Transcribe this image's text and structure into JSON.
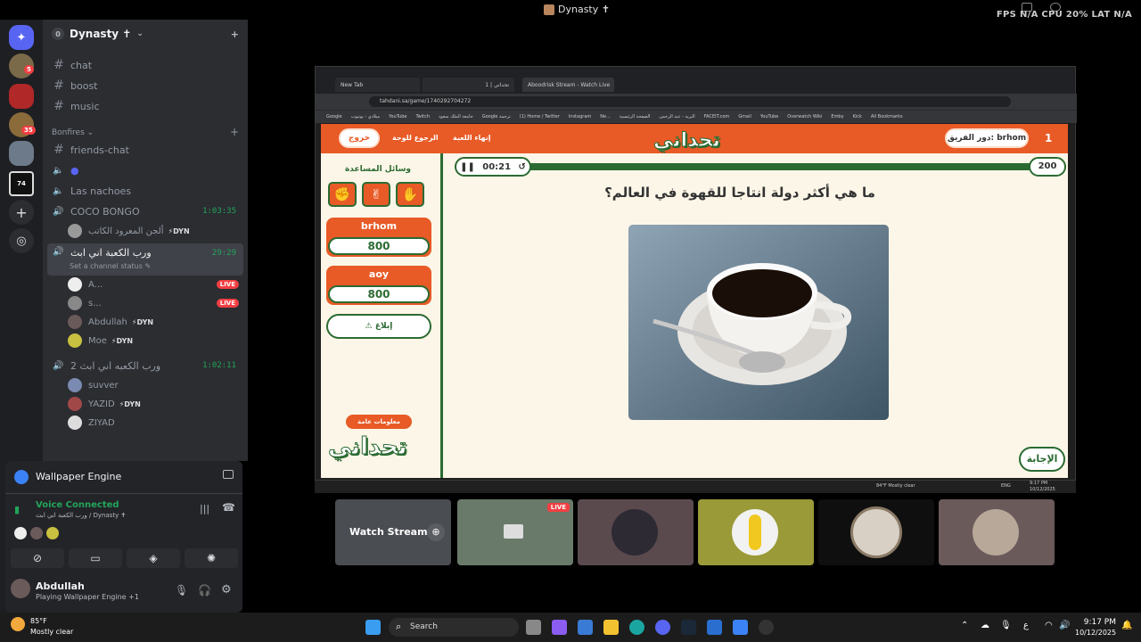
{
  "titlebar": {
    "title": "Dynasty ✝",
    "stats": "FPS N/A   CPU 20%   LAT N/A"
  },
  "server": {
    "name": "Dynasty ✝",
    "level": "0"
  },
  "guild_badges": [
    "5",
    "35"
  ],
  "channels": {
    "text": [
      "chat",
      "boost",
      "music"
    ],
    "category": "Bonfires",
    "friends_chat": "friends-chat",
    "voice_nachoes": "Las nachoes",
    "coco": {
      "name": "COCO BONGO",
      "time": "1:03:35"
    },
    "coco_user": {
      "name": "ألجن المعرود الكاتب",
      "tag": "⚡DYN"
    },
    "active": {
      "name": "ورب الكعبة اني ابث",
      "status": "Set a channel status ✎",
      "time": "29:29"
    },
    "active_users": [
      {
        "name": "A...",
        "live": "LIVE"
      },
      {
        "name": "s...",
        "live": "LIVE"
      },
      {
        "name": "Abdullah",
        "tag": "⚡DYN"
      },
      {
        "name": "Moe",
        "tag": "⚡DYN"
      }
    ],
    "second": {
      "name": "ورب الكعبه اني ابث 2",
      "time": "1:02:11"
    },
    "second_users": [
      {
        "name": "suvver"
      },
      {
        "name": "YAZID",
        "tag": "⚡DYN"
      },
      {
        "name": "ZIYAD"
      }
    ]
  },
  "panel": {
    "activity": "Wallpaper Engine",
    "voice_status": "Voice Connected",
    "voice_channel": "ورب الكعبة اني ابث / Dynasty ✝",
    "user_name": "Abdullah",
    "user_status": "Playing Wallpaper Engine +1"
  },
  "browser": {
    "tabs": [
      "New Tab",
      "تحداني | 1",
      "Aboodrisk Stream - Watch Live"
    ],
    "url": "tahdani.sa/game/1740292704272",
    "bookmarks": [
      "Google",
      "ميلادي - يوتيوب",
      "YouTube",
      "Twitch",
      "جامعة الملك سعود",
      "Google ترجمة",
      "(1) Home / Twitter",
      "Instagram",
      "Ne...",
      "الصفحة الرئيسية",
      "البريد - عبد الرحمن",
      "FACEIT.com",
      "Gmail",
      "YouTube",
      "Overwatch Wiki",
      "Emby",
      "Kick",
      "All Bookmarks"
    ]
  },
  "game": {
    "exit": "خروج",
    "back": "الرجوع للوحة",
    "end": "إنهاء اللعبة",
    "logo": "تحداني",
    "turn_label": "دور الفريق: brhom",
    "turn_number": "1",
    "help_title": "وسائل المساعدة",
    "teams": [
      {
        "name": "brhom",
        "score": "800"
      },
      {
        "name": "aoy",
        "score": "800"
      }
    ],
    "report": "⚠ إبلاغ",
    "info": "معلومات عامة",
    "timer": "00:21",
    "points": "200",
    "question": "ما هي أكثر دولة انتاجا للقهوة في العالم؟",
    "answer": "الإجابة"
  },
  "stream_taskbar": {
    "weather": "84°F  Mostly clear",
    "lang": "ENG",
    "time": "9:17 PM",
    "date": "10/12/2025"
  },
  "tiles": {
    "watch": "Watch Stream",
    "live": "LIVE"
  },
  "taskbar": {
    "weather_temp": "85°F",
    "weather_desc": "Mostly clear",
    "search": "Search",
    "lang": "ع",
    "time": "9:17 PM",
    "date": "10/12/2025"
  }
}
